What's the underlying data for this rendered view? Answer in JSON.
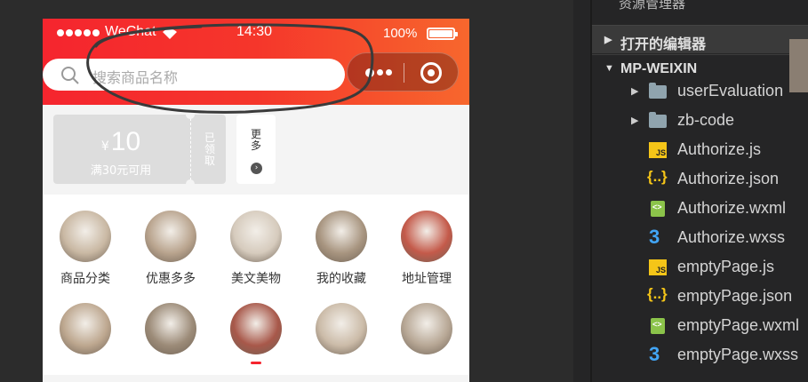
{
  "phone": {
    "status": {
      "carrier": "WeChat",
      "time": "14:30",
      "battery": "100%"
    },
    "search": {
      "placeholder": "搜索商品名称"
    },
    "coupon": {
      "currency": "¥",
      "amount": "10",
      "condition": "满30元可用",
      "claim": "已领取"
    },
    "more": "更多",
    "grid": [
      {
        "label": "商品分类"
      },
      {
        "label": "优惠多多"
      },
      {
        "label": "美文美物"
      },
      {
        "label": "我的收藏"
      },
      {
        "label": "地址管理"
      },
      {
        "label": ""
      },
      {
        "label": ""
      },
      {
        "label": ""
      },
      {
        "label": ""
      },
      {
        "label": ""
      }
    ]
  },
  "explorer": {
    "title": "资源管理器",
    "open_editors": "打开的编辑器",
    "project": "MP-WEIXIN",
    "files": [
      {
        "name": "userEvaluation",
        "type": "folder"
      },
      {
        "name": "zb-code",
        "type": "folder"
      },
      {
        "name": "Authorize.js",
        "type": "js"
      },
      {
        "name": "Authorize.json",
        "type": "json"
      },
      {
        "name": "Authorize.wxml",
        "type": "wxml"
      },
      {
        "name": "Authorize.wxss",
        "type": "wxss"
      },
      {
        "name": "emptyPage.js",
        "type": "js"
      },
      {
        "name": "emptyPage.json",
        "type": "json"
      },
      {
        "name": "emptyPage.wxml",
        "type": "wxml"
      },
      {
        "name": "emptyPage.wxss",
        "type": "wxss"
      }
    ]
  },
  "colors": {
    "brand_red": "#f5252e",
    "brand_orange": "#f7672d",
    "panel_bg": "#252526"
  }
}
